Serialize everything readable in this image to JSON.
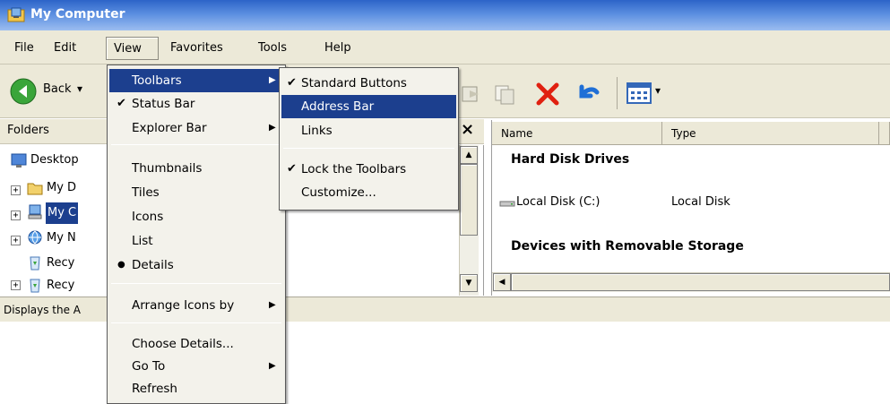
{
  "window": {
    "title": "My Computer"
  },
  "menubar": {
    "file": "File",
    "edit": "Edit",
    "view": "View",
    "favorites": "Favorites",
    "tools": "Tools",
    "help": "Help"
  },
  "toolbar": {
    "back_label": "Back"
  },
  "folders": {
    "header": "Folders",
    "close_glyph": "×",
    "tree": [
      {
        "label": "Desktop"
      },
      {
        "label": "My D"
      },
      {
        "label": "My C"
      },
      {
        "label": "My N"
      },
      {
        "label": "Recy"
      },
      {
        "label": "Recy"
      }
    ]
  },
  "view_menu": {
    "items": {
      "toolbars": "Toolbars",
      "status_bar": "Status Bar",
      "explorer_bar": "Explorer Bar",
      "thumbnails": "Thumbnails",
      "tiles": "Tiles",
      "icons": "Icons",
      "list": "List",
      "details": "Details",
      "arrange_icons_by": "Arrange Icons by",
      "choose_details": "Choose Details...",
      "go_to": "Go To",
      "refresh": "Refresh"
    },
    "checked": "Status Bar",
    "selected_view": "Details"
  },
  "toolbars_submenu": {
    "items": {
      "standard_buttons": "Standard Buttons",
      "address_bar": "Address Bar",
      "links": "Links",
      "lock_toolbars": "Lock the Toolbars",
      "customize": "Customize..."
    },
    "highlighted": "Address Bar"
  },
  "details": {
    "columns": {
      "name": "Name",
      "type": "Type"
    },
    "groups": {
      "hard_disk": "Hard Disk Drives",
      "removable": "Devices with Removable Storage"
    },
    "rows": [
      {
        "name": "Local Disk (C:)",
        "type": "Local Disk"
      }
    ]
  },
  "status": {
    "text": "Displays the A"
  },
  "glyphs": {
    "check": "✔",
    "bullet": "●",
    "submenu_arrow": "▶",
    "up_arrow": "▲",
    "down_arrow": "▼",
    "left_arrow": "◀",
    "expand": "+",
    "dropdown": "▾"
  },
  "colors": {
    "title_gradient_start": "#2d64c8",
    "menu_highlight": "#1c3f8e",
    "chrome": "#ece9d8",
    "delete_red": "#e02010",
    "undo_blue": "#1f6fd6",
    "back_green": "#3aa53a"
  }
}
